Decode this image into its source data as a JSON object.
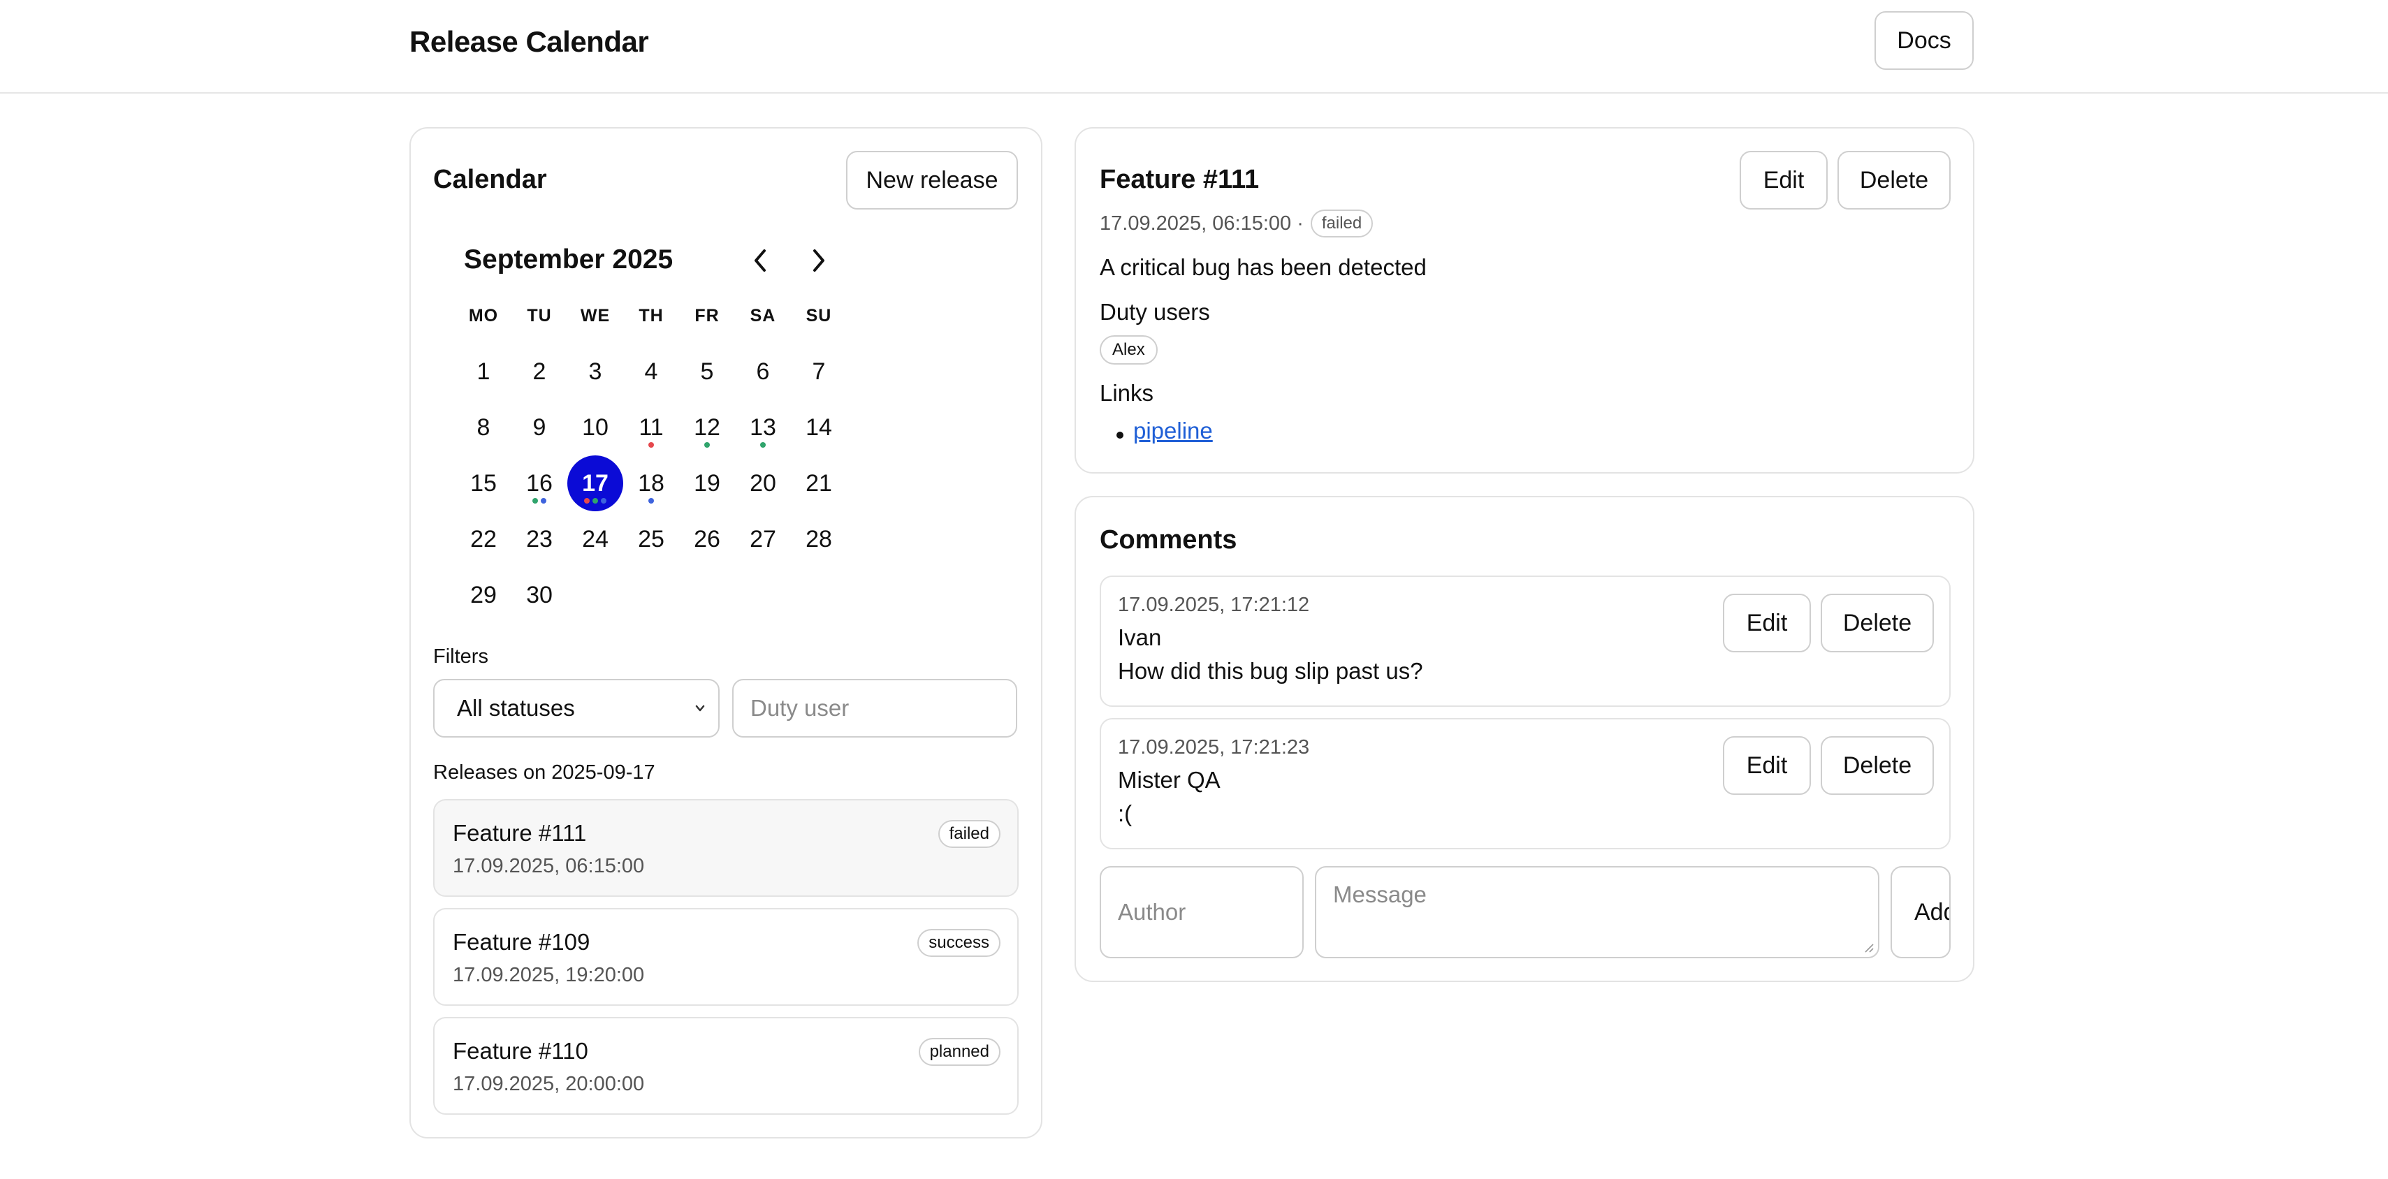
{
  "header": {
    "title": "Release Calendar",
    "docs_label": "Docs"
  },
  "calendar": {
    "title": "Calendar",
    "new_release_label": "New release",
    "month_label": "September 2025",
    "prev_icon": "chevron-left-icon",
    "next_icon": "chevron-right-icon",
    "weekdays": [
      "MO",
      "TU",
      "WE",
      "TH",
      "FR",
      "SA",
      "SU"
    ],
    "selected_day": 17,
    "days": [
      "1",
      "2",
      "3",
      "4",
      "5",
      "6",
      "7",
      "8",
      "9",
      "10",
      "11",
      "12",
      "13",
      "14",
      "15",
      "16",
      "17",
      "18",
      "19",
      "20",
      "21",
      "22",
      "23",
      "24",
      "25",
      "26",
      "27",
      "28",
      "29",
      "30"
    ],
    "status_colors": {
      "failed": "#e5484d",
      "success": "#30a46c",
      "planned": "#3e63dd"
    },
    "markers": {
      "11": [
        "failed"
      ],
      "12": [
        "success"
      ],
      "13": [
        "success"
      ],
      "16": [
        "success",
        "planned"
      ],
      "17": [
        "failed",
        "success",
        "planned"
      ],
      "18": [
        "planned"
      ]
    },
    "selected_color": "#0b0bd6"
  },
  "filters": {
    "label": "Filters",
    "status_value": "All statuses",
    "duty_placeholder": "Duty user"
  },
  "releases": {
    "label": "Releases on 2025-09-17",
    "items": [
      {
        "name": "Feature #111",
        "time": "17.09.2025, 06:15:00",
        "status": "failed"
      },
      {
        "name": "Feature #109",
        "time": "17.09.2025, 19:20:00",
        "status": "success"
      },
      {
        "name": "Feature #110",
        "time": "17.09.2025, 20:00:00",
        "status": "planned"
      }
    ]
  },
  "detail": {
    "title": "Feature #111",
    "edit_label": "Edit",
    "delete_label": "Delete",
    "datetime": "17.09.2025, 06:15:00 ·",
    "status": "failed",
    "description": "A critical bug has been detected",
    "duty_users_label": "Duty users",
    "duty_users": [
      "Alex"
    ],
    "links_label": "Links",
    "links": [
      "pipeline"
    ]
  },
  "comments": {
    "title": "Comments",
    "items": [
      {
        "time": "17.09.2025, 17:21:12",
        "author": "Ivan",
        "text": "How did this bug slip past us?",
        "edit_label": "Edit",
        "delete_label": "Delete"
      },
      {
        "time": "17.09.2025, 17:21:23",
        "author": "Mister QA",
        "text": ":(",
        "edit_label": "Edit",
        "delete_label": "Delete"
      }
    ],
    "author_placeholder": "Author",
    "message_placeholder": "Message",
    "add_label": "Add"
  }
}
